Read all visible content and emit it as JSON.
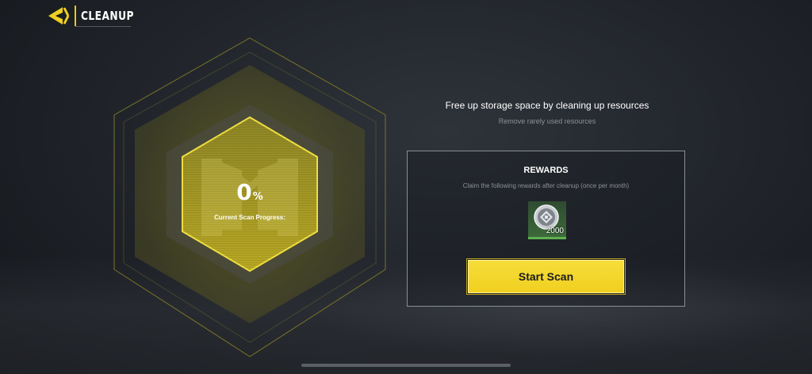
{
  "header": {
    "title": "CLEANUP",
    "back_icon": "back-arrow-icon"
  },
  "scan": {
    "progress_value": "0",
    "progress_unit": "%",
    "progress_label": "Current Scan Progress:",
    "progress_fraction": 0
  },
  "info": {
    "title": "Free up storage space by cleaning up resources",
    "subtitle": "Remove rarely used resources"
  },
  "rewards": {
    "title": "REWARDS",
    "description": "Claim the following rewards after cleanup (once per month)",
    "items": [
      {
        "icon": "credits-coin-icon",
        "quantity": "2000"
      }
    ]
  },
  "actions": {
    "start_scan_label": "Start Scan"
  },
  "colors": {
    "accent": "#f0d020",
    "reward_bg": "#3c6a3a"
  }
}
